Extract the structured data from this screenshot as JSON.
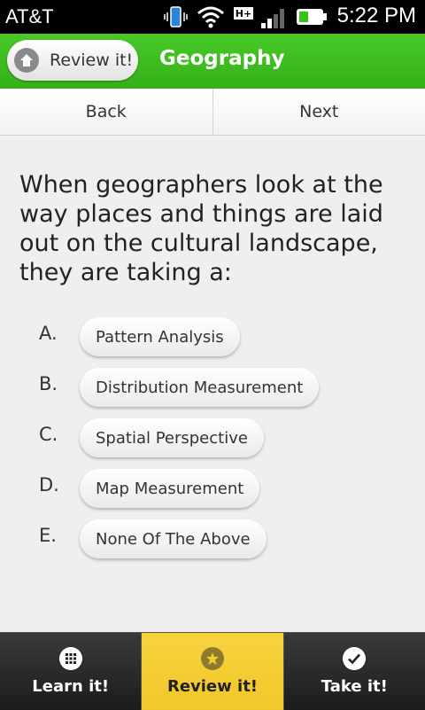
{
  "status_bar": {
    "carrier": "AT&T",
    "time": "5:22 PM",
    "icons": [
      "vibrate-icon",
      "wifi-icon",
      "hplus-icon",
      "signal-icon",
      "battery-icon"
    ]
  },
  "header": {
    "review_button_label": "Review it!",
    "title": "Geography"
  },
  "nav": {
    "back_label": "Back",
    "next_label": "Next"
  },
  "question": {
    "text": "When geographers look at the way places and things are laid out on the cultural landscape, they are taking a:"
  },
  "choices": [
    {
      "letter": "A.",
      "label": "Pattern Analysis"
    },
    {
      "letter": "B.",
      "label": "Distribution Measurement"
    },
    {
      "letter": "C.",
      "label": "Spatial Perspective"
    },
    {
      "letter": "D.",
      "label": "Map Measurement"
    },
    {
      "letter": "E.",
      "label": "None Of The Above"
    }
  ],
  "tabs": [
    {
      "label": "Learn it!",
      "icon": "grid-icon",
      "active": false
    },
    {
      "label": "Review it!",
      "icon": "star-icon",
      "active": true
    },
    {
      "label": "Take it!",
      "icon": "check-icon",
      "active": false
    }
  ],
  "colors": {
    "header_green": "#3fbf1f",
    "active_tab_yellow": "#f4cc32"
  }
}
